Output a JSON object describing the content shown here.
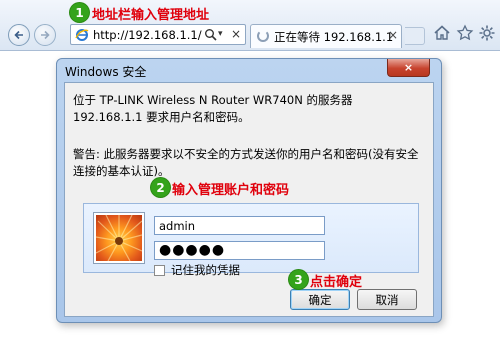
{
  "browser": {
    "address_url": "http://192.168.1.1/",
    "tab_title": "正在等待 192.168.1.1",
    "search_icon": "search-icon",
    "close_glyph": "×"
  },
  "steps": [
    {
      "number": "1",
      "text": "地址栏输入管理地址"
    },
    {
      "number": "2",
      "text": "输入管理账户和密码"
    },
    {
      "number": "3",
      "text": "点击确定"
    }
  ],
  "dialog": {
    "title": "Windows 安全",
    "message": "位于 TP-LINK Wireless N Router WR740N 的服务器 192.168.1.1 要求用户名和密码。",
    "warning": "警告: 此服务器要求以不安全的方式发送你的用户名和密码(没有安全连接的基本认证)。",
    "username_value": "admin",
    "password_mask": "●●●●●",
    "remember_label": "记住我的凭据",
    "remember_checked": false,
    "ok_label": "确定",
    "cancel_label": "取消"
  },
  "colors": {
    "step_badge": "#34a31b",
    "step_text": "#e0000c",
    "dialog_frame": "#a9c6ea"
  }
}
